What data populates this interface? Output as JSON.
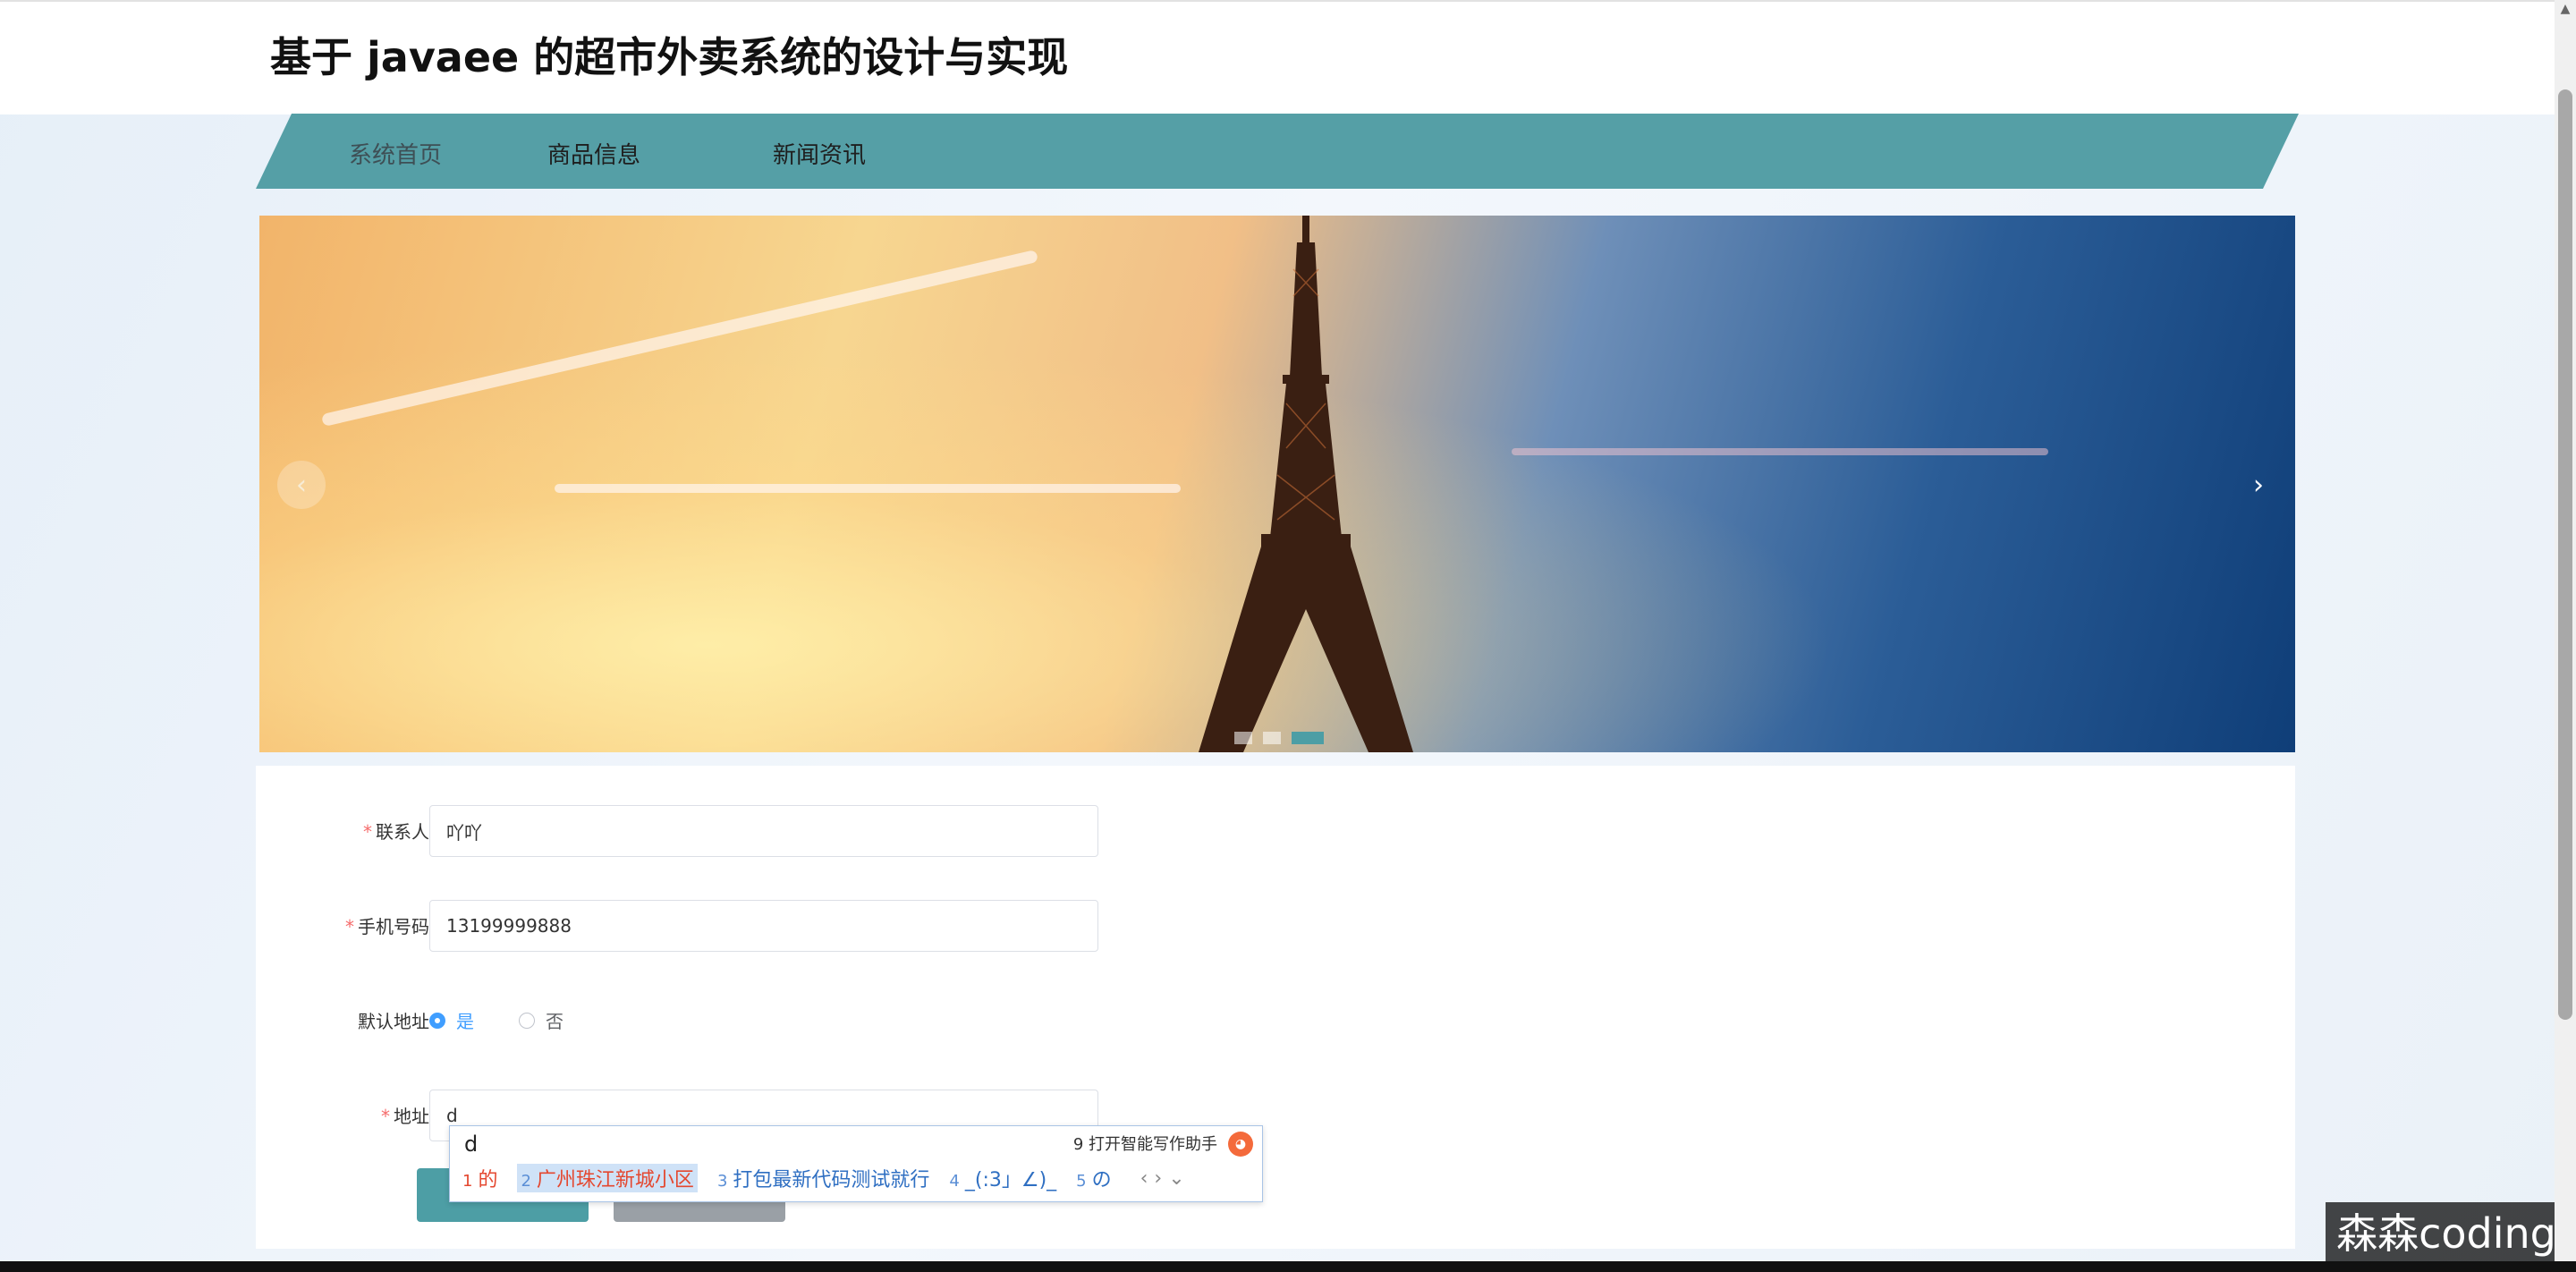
{
  "header": {
    "title": "基于 javaee 的超市外卖系统的设计与实现"
  },
  "nav": {
    "items": [
      {
        "label": "系统首页"
      },
      {
        "label": "商品信息"
      },
      {
        "label": "新闻资讯"
      }
    ],
    "accent_color": "#559fa6"
  },
  "carousel": {
    "prev_icon": "chevron-left-icon",
    "next_icon": "chevron-right-icon",
    "prev_symbol": "‹",
    "next_symbol": "›",
    "slides_count": 3,
    "active_index": 2
  },
  "form": {
    "contact": {
      "label": "联系人",
      "value": "吖吖",
      "required": true
    },
    "phone": {
      "label": "手机号码",
      "value": "13199999888",
      "required": true
    },
    "default_address": {
      "label": "默认地址",
      "options": [
        {
          "label": "是",
          "checked": true
        },
        {
          "label": "否",
          "checked": false
        }
      ]
    },
    "address": {
      "label": "地址",
      "value": "d",
      "required": true
    },
    "buttons": {
      "save": "",
      "reset": ""
    }
  },
  "ime": {
    "composition": "d",
    "assist": "9 打开智能写作助手",
    "candidates": [
      {
        "num": "1",
        "text": "的"
      },
      {
        "num": "2",
        "text": "广州珠江新城小区"
      },
      {
        "num": "3",
        "text": "打包最新代码测试就行"
      },
      {
        "num": "4",
        "text": "_(:3」∠)_"
      },
      {
        "num": "5",
        "text": "の"
      }
    ],
    "nav": "‹ › ⌄"
  },
  "watermark": "森森coding"
}
